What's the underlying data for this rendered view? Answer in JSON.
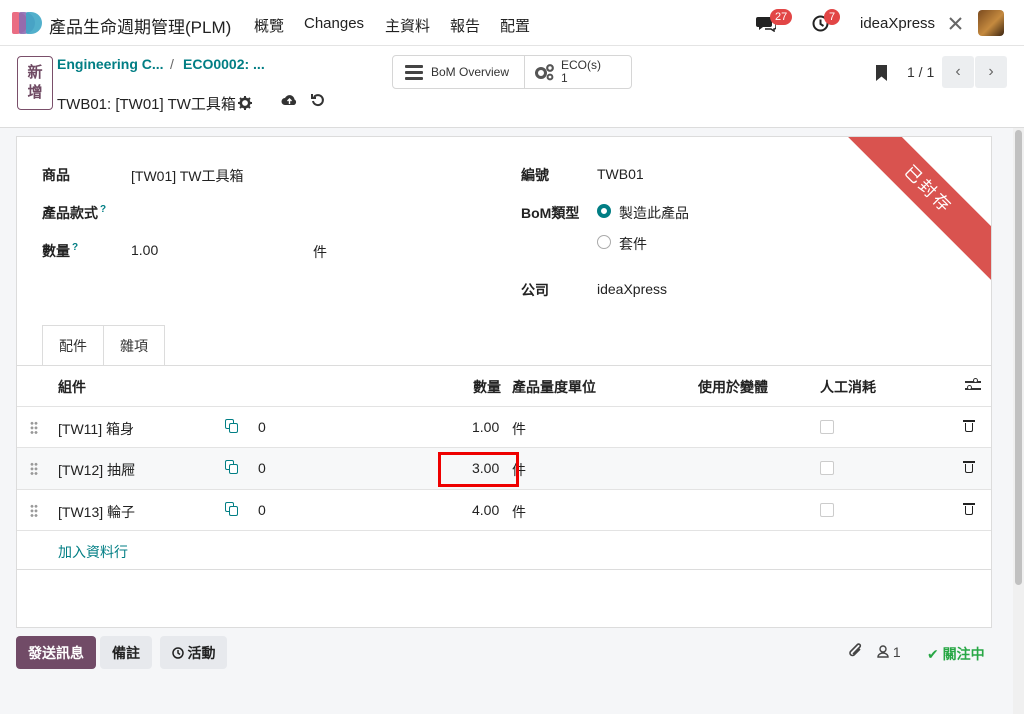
{
  "navbar": {
    "app_title": "產品生命週期管理(PLM)",
    "menu": [
      "概覽",
      "Changes",
      "主資料",
      "報告",
      "配置"
    ],
    "messages_count": "27",
    "activities_count": "7",
    "user_name": "ideaXpress"
  },
  "control": {
    "new_label_1": "新",
    "new_label_2": "增",
    "breadcrumb_1": "Engineering C...",
    "breadcrumb_2": "ECO0002: ...",
    "record_title": "TWB01: [TW01] TW工具箱",
    "bom_overview": "BoM Overview",
    "eco_label": "ECO(s)",
    "eco_count": "1",
    "pager": "1 / 1"
  },
  "form": {
    "product_label": "商品",
    "product_value": "[TW01] TW工具箱",
    "variant_label": "產品款式",
    "qty_label": "數量",
    "qty_value": "1.00",
    "qty_uom": "件",
    "ref_label": "編號",
    "ref_value": "TWB01",
    "bom_type_label": "BoM類型",
    "bom_type_opt1": "製造此產品",
    "bom_type_opt2": "套件",
    "company_label": "公司",
    "company_value": "ideaXpress",
    "ribbon": "已封存",
    "help_mark": "?"
  },
  "tabs": [
    "配件",
    "雜項"
  ],
  "table": {
    "headers": {
      "component": "組件",
      "qty": "數量",
      "uom": "產品量度單位",
      "variants": "使用於變體",
      "manual": "人工消耗"
    },
    "rows": [
      {
        "component": "[TW11] 箱身",
        "count": "0",
        "qty": "1.00",
        "uom": "件"
      },
      {
        "component": "[TW12] 抽屜",
        "count": "0",
        "qty": "3.00",
        "uom": "件"
      },
      {
        "component": "[TW13] 輪子",
        "count": "0",
        "qty": "4.00",
        "uom": "件"
      }
    ],
    "add_line": "加入資料行"
  },
  "chatter": {
    "send": "發送訊息",
    "note": "備註",
    "activity": "活動",
    "followers": "1",
    "following": "關注中"
  },
  "colors": {
    "brand": "#714b67",
    "teal": "#017e84",
    "ribbon": "#d9534f",
    "highlight": "#e00000"
  }
}
